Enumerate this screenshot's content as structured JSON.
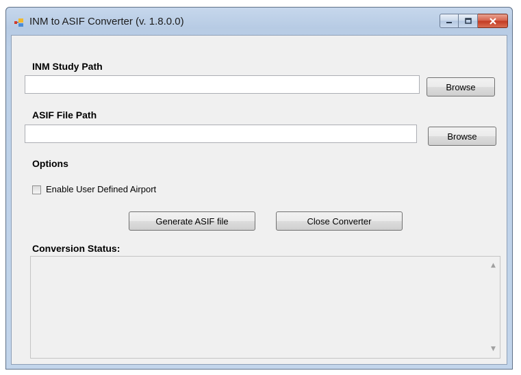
{
  "window": {
    "title": "INM to ASIF Converter (v. 1.8.0.0)"
  },
  "form": {
    "inm_label": "INM Study Path",
    "inm_value": "",
    "inm_browse": "Browse",
    "asif_label": "ASIF File Path",
    "asif_value": "",
    "asif_browse": "Browse",
    "options_label": "Options",
    "checkbox_label": "Enable User Defined Airport",
    "checkbox_checked": false,
    "generate_button": "Generate ASIF file",
    "close_button": "Close Converter",
    "status_label": "Conversion Status:",
    "status_text": ""
  }
}
